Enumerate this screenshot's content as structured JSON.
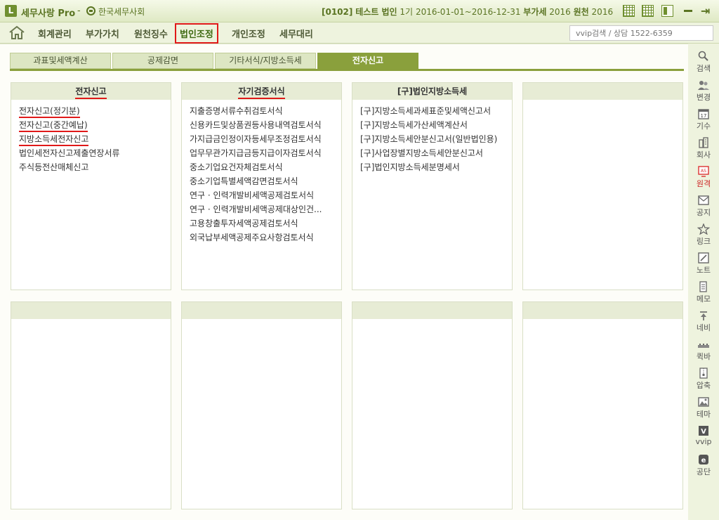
{
  "titlebar": {
    "logo": "L",
    "app_title": "세무사랑 Pro",
    "separator": "-",
    "org_name": "한국세무사회",
    "company_code": "[0102]",
    "company_name": "테스트 법인",
    "term": "1기",
    "period": "2016-01-01~2016-12-31",
    "vat_label": "부가세",
    "vat_year": "2016",
    "withholding_label": "원천",
    "withholding_year": "2016"
  },
  "menu": {
    "items": [
      "회계관리",
      "부가가치",
      "원천징수",
      "법인조정",
      "개인조정",
      "세무대리"
    ],
    "active_index": 3,
    "search_placeholder": "vvip검색 / 상담 1522-6359"
  },
  "tabs": [
    "과표및세액계산",
    "공제감면",
    "기타서식/지방소득세",
    "전자신고"
  ],
  "active_tab": 3,
  "panels": [
    {
      "title": "전자신고",
      "title_underlined": true,
      "items": [
        {
          "label": "전자신고(정기분)",
          "underlined": true
        },
        {
          "label": "전자신고(중간예납)",
          "underlined": true
        },
        {
          "label": "지방소득세전자신고",
          "underlined": true
        },
        {
          "label": "법인세전자신고제출연장서류",
          "underlined": false
        },
        {
          "label": "주식등전산매체신고",
          "underlined": false
        }
      ]
    },
    {
      "title": "자기검증서식",
      "title_underlined": true,
      "items": [
        {
          "label": "지출증명서류수취검토서식"
        },
        {
          "label": "신용카드및상품권등사용내역검토서식"
        },
        {
          "label": "가지급금인정이자등세무조정검토서식"
        },
        {
          "label": "업무무관가지급금등지급이자검토서식"
        },
        {
          "label": "중소기업요건자체검토서식"
        },
        {
          "label": "중소기업특별세액감면검토서식"
        },
        {
          "label": "연구 · 인력개발비세액공제검토서식"
        },
        {
          "label": "연구 · 인력개발비세액공제대상인건..."
        },
        {
          "label": "고용창출투자세액공제검토서식"
        },
        {
          "label": "외국납부세액공제주요사항검토서식"
        }
      ]
    },
    {
      "title": "[구]법인지방소득세",
      "title_underlined": false,
      "items": [
        {
          "label": "[구]지방소득세과세표준및세액신고서"
        },
        {
          "label": "[구]지방소득세가산세액계산서"
        },
        {
          "label": "[구]지방소득세안분신고서(일반법인용)"
        },
        {
          "label": "[구]사업장별지방소득세안분신고서"
        },
        {
          "label": "[구]법인지방소득세분명세서"
        }
      ]
    },
    {
      "title": "",
      "items": []
    },
    {
      "title": "",
      "items": []
    },
    {
      "title": "",
      "items": []
    },
    {
      "title": "",
      "items": []
    },
    {
      "title": "",
      "items": []
    }
  ],
  "sidebar": [
    {
      "label": "검색",
      "icon": "search-icon"
    },
    {
      "label": "변경",
      "icon": "users-icon"
    },
    {
      "label": "기수",
      "icon": "calendar-icon"
    },
    {
      "label": "회사",
      "icon": "building-icon"
    },
    {
      "label": "원격",
      "icon": "remote-icon",
      "highlight": true
    },
    {
      "label": "공지",
      "icon": "notice-icon"
    },
    {
      "label": "링크",
      "icon": "star-icon"
    },
    {
      "label": "노트",
      "icon": "note-icon"
    },
    {
      "label": "메모",
      "icon": "memo-icon"
    },
    {
      "label": "네비",
      "icon": "navi-icon"
    },
    {
      "label": "퀵바",
      "icon": "quickbar-icon"
    },
    {
      "label": "압축",
      "icon": "compress-icon"
    },
    {
      "label": "테마",
      "icon": "theme-icon"
    },
    {
      "label": "vvip",
      "icon": "vvip-icon"
    },
    {
      "label": "공단",
      "icon": "agency-icon"
    }
  ]
}
